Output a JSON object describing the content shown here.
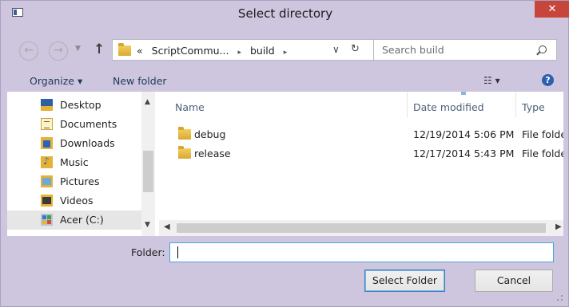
{
  "window": {
    "title": "Select directory",
    "close_label": "✕"
  },
  "nav": {
    "back_glyph": "←",
    "forward_glyph": "→",
    "up_glyph": "↑",
    "address": {
      "overflow": "«",
      "segments": [
        "ScriptCommu...",
        "build"
      ],
      "separator": "▸",
      "dropdown_glyph": "∨",
      "refresh_glyph": "↻"
    },
    "search": {
      "placeholder": "Search build"
    }
  },
  "toolbar": {
    "organize_label": "Organize ▾",
    "new_folder_label": "New folder",
    "view_label": "☷ ▾",
    "help_label": "?"
  },
  "sidebar": {
    "items": [
      {
        "label": "Desktop",
        "icon": "desktop-icon"
      },
      {
        "label": "Documents",
        "icon": "documents-icon"
      },
      {
        "label": "Downloads",
        "icon": "downloads-icon"
      },
      {
        "label": "Music",
        "icon": "music-icon"
      },
      {
        "label": "Pictures",
        "icon": "pictures-icon"
      },
      {
        "label": "Videos",
        "icon": "videos-icon"
      },
      {
        "label": "Acer (C:)",
        "icon": "drive-icon",
        "selected": true
      }
    ]
  },
  "files": {
    "columns": [
      "Name",
      "Date modified",
      "Type"
    ],
    "rows": [
      {
        "name": "debug",
        "date": "12/19/2014 5:06 PM",
        "type": "File folder"
      },
      {
        "name": "release",
        "date": "12/17/2014 5:43 PM",
        "type": "File folder"
      }
    ]
  },
  "footer": {
    "folder_label": "Folder:",
    "folder_value": "",
    "select_label": "Select Folder",
    "cancel_label": "Cancel"
  },
  "colors": {
    "frame": "#cdc6de",
    "close": "#c7463c",
    "accent": "#4aa3df"
  }
}
